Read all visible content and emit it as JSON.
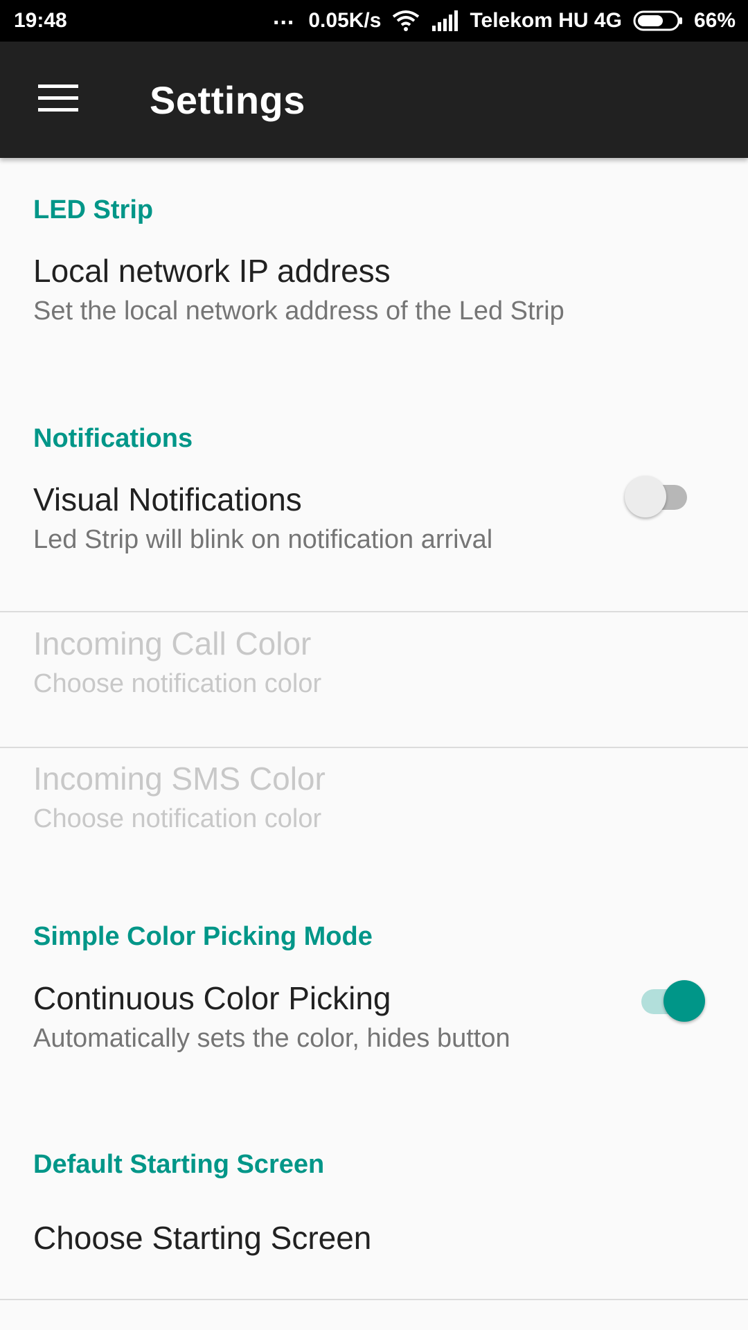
{
  "status_bar": {
    "time": "19:48",
    "more_indicator": "...",
    "net_speed": "0.05K/s",
    "carrier": "Telekom HU 4G",
    "battery_percent": "66%",
    "battery_level": 0.66,
    "icons": [
      "wifi-icon",
      "signal-icon",
      "battery-icon"
    ]
  },
  "toolbar": {
    "menu_icon": "menu-icon",
    "title": "Settings"
  },
  "sections": {
    "led_strip": {
      "header": "LED Strip",
      "ip_pref": {
        "title": "Local network IP address",
        "summary": "Set the local network address of the Led Strip"
      }
    },
    "notifications": {
      "header": "Notifications",
      "visual": {
        "title": "Visual Notifications",
        "summary": "Led Strip will blink on notification arrival",
        "checked": false
      },
      "call_color": {
        "title": "Incoming Call Color",
        "summary": "Choose notification color",
        "enabled": false
      },
      "sms_color": {
        "title": "Incoming SMS Color",
        "summary": "Choose notification color",
        "enabled": false
      }
    },
    "simple_color": {
      "header": "Simple Color Picking Mode",
      "continuous": {
        "title": "Continuous Color Picking",
        "summary": "Automatically sets the color, hides button",
        "checked": true
      }
    },
    "default_screen": {
      "header": "Default Starting Screen",
      "choose": {
        "title": "Choose Starting Screen"
      }
    }
  },
  "colors": {
    "accent": "#009688",
    "toolbar": "#212121",
    "background": "#fafafa"
  }
}
